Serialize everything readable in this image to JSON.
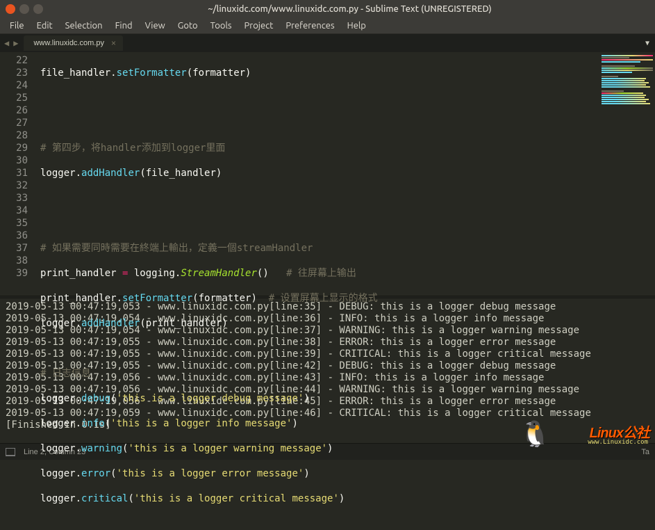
{
  "window": {
    "title": "~/linuxidc.com/www.linuxidc.com.py - Sublime Text (UNREGISTERED)"
  },
  "menu": {
    "items": [
      "File",
      "Edit",
      "Selection",
      "Find",
      "View",
      "Goto",
      "Tools",
      "Project",
      "Preferences",
      "Help"
    ]
  },
  "tab": {
    "name": "www.linuxidc.com.py"
  },
  "lines": {
    "numbers": [
      "22",
      "23",
      "24",
      "25",
      "26",
      "27",
      "28",
      "29",
      "30",
      "31",
      "32",
      "33",
      "34",
      "35",
      "36",
      "37",
      "38",
      "39"
    ],
    "l22_a": "file_handler",
    "l22_b": "setFormatter",
    "l22_c": "formatter",
    "l25": "# 第四步，将handler添加到logger里面",
    "l26_a": "logger",
    "l26_b": "addHandler",
    "l26_c": "file_handler",
    "l29": "# 如果需要同時需要在終端上輸出，定義一個streamHandler",
    "l30_a": "print_handler",
    "l30_op": " = ",
    "l30_b": "logging",
    "l30_c": "StreamHandler",
    "l30_d": "# 往屏幕上输出",
    "l31_a": "print_handler",
    "l31_b": "setFormatter",
    "l31_c": "formatter",
    "l31_d": "# 设置屏幕上显示的格式",
    "l32_a": "logger",
    "l32_b": "addHandler",
    "l32_c": "print_handler",
    "l34": "# 日志信息",
    "l35_a": "logger",
    "l35_b": "debug",
    "l35_c": "'this is a logger debug message'",
    "l36_a": "logger",
    "l36_b": "info",
    "l36_c": "'this is a logger info message'",
    "l37_a": "logger",
    "l37_b": "warning",
    "l37_c": "'this is a logger warning message'",
    "l38_a": "logger",
    "l38_b": "error",
    "l38_c": "'this is a logger error message'",
    "l39_a": "logger",
    "l39_b": "critical",
    "l39_c": "'this is a logger critical message'"
  },
  "console": {
    "l1": "2019-05-13 00:47:19,053 - www.linuxidc.com.py[line:35] - DEBUG: this is a logger debug message",
    "l2": "2019-05-13 00:47:19,054 - www.linuxidc.com.py[line:36] - INFO: this is a logger info message",
    "l3": "2019-05-13 00:47:19,054 - www.linuxidc.com.py[line:37] - WARNING: this is a logger warning message",
    "l4": "2019-05-13 00:47:19,055 - www.linuxidc.com.py[line:38] - ERROR: this is a logger error message",
    "l5": "2019-05-13 00:47:19,055 - www.linuxidc.com.py[line:39] - CRITICAL: this is a logger critical message",
    "l6": "2019-05-13 00:47:19,055 - www.linuxidc.com.py[line:42] - DEBUG: this is a logger debug message",
    "l7": "2019-05-13 00:47:19,056 - www.linuxidc.com.py[line:43] - INFO: this is a logger info message",
    "l8": "2019-05-13 00:47:19,056 - www.linuxidc.com.py[line:44] - WARNING: this is a logger warning message",
    "l9": "2019-05-13 00:47:19,056 - www.linuxidc.com.py[line:45] - ERROR: this is a logger error message",
    "l10": "2019-05-13 00:47:19,059 - www.linuxidc.com.py[line:46] - CRITICAL: this is a logger critical message",
    "l11": "[Finished in 0.1s]"
  },
  "status": {
    "pos": "Line 2, Column 23",
    "right": "Ta"
  },
  "watermark": {
    "logo": "Linux公社",
    "url": "www.Linuxidc.com"
  },
  "mascot": "🐧"
}
